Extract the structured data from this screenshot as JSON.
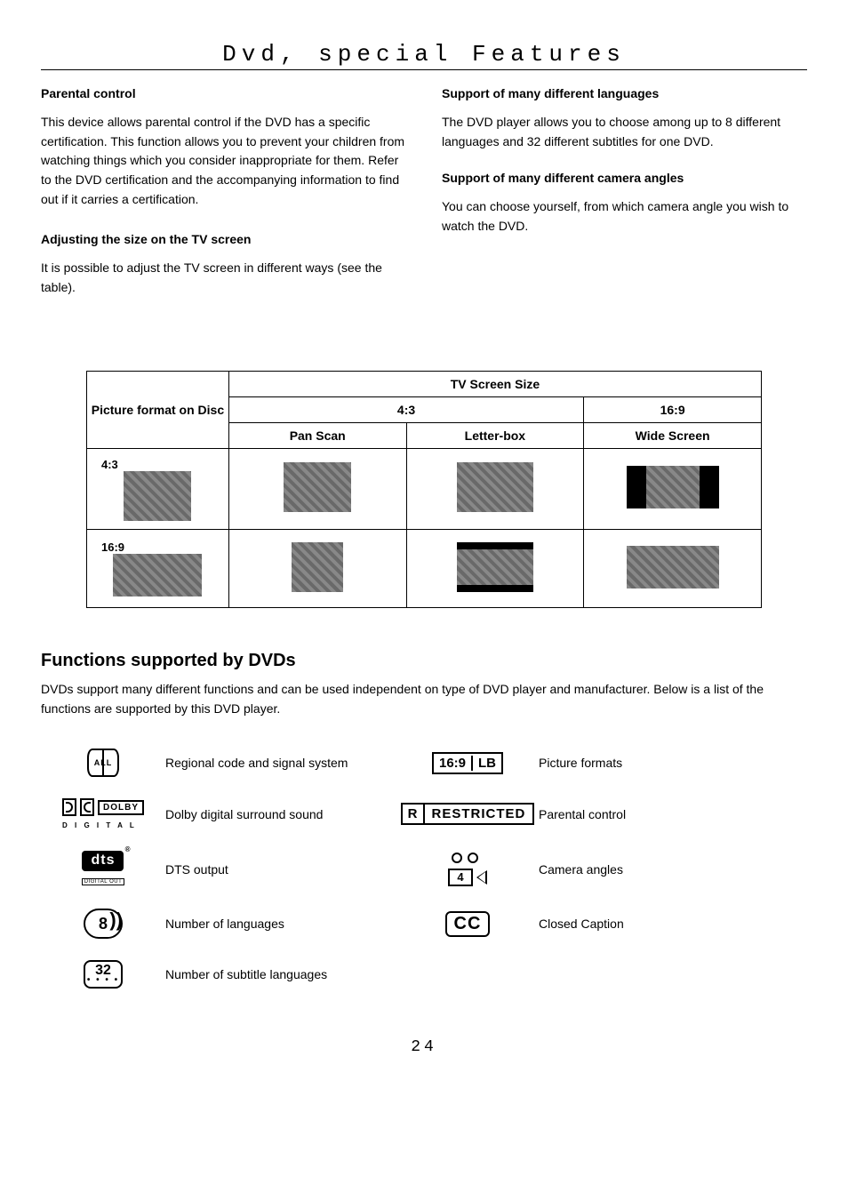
{
  "title": "Dvd, special Features",
  "left": {
    "h1": "Parental control",
    "p1": "This device allows parental control if the DVD has a specific certification. This function allows you to prevent your children from watching things which you consider inappropriate for them. Refer to the DVD certification and the accompanying information to find out if it carries a certification.",
    "h2": "Adjusting the size on the TV screen",
    "p2": "It is possible to adjust the TV screen in different ways (see the table)."
  },
  "right": {
    "h1": "Support of many different languages",
    "p1": "The DVD player allows you to choose among up to 8 different languages and 32 different subtitles for one DVD.",
    "h2": "Support of many different camera angles",
    "p2": "You can choose yourself, from which camera angle you wish to watch the DVD."
  },
  "table": {
    "tv_screen_size": "TV Screen Size",
    "picture_format": "Picture format on Disc",
    "r43": "4:3",
    "r169": "16:9",
    "pan_scan": "Pan Scan",
    "letter_box": "Letter-box",
    "wide_screen": "Wide Screen",
    "row1": "4:3",
    "row2": "16:9"
  },
  "funcs": {
    "heading": "Functions supported by DVDs",
    "intro": "DVDs support many different functions and can be used independent on type of DVD player and manufacturer. Below is a list of the functions are supported by this DVD player.",
    "items": {
      "regional": "Regional code and signal system",
      "dolby": "Dolby digital surround sound",
      "dts": "DTS output",
      "languages": "Number of languages",
      "subtitles": "Number of subtitle languages",
      "picture_formats": "Picture formats",
      "parental": "Parental control",
      "camera": "Camera angles",
      "cc": "Closed Caption"
    },
    "labels": {
      "globe": "ALL",
      "dolby_box": "DOLBY",
      "dolby_sub": "D I G I T A L",
      "dts": "dts",
      "dts_sub": "DIGITAL OUT",
      "lang_num": "8",
      "sub_num": "32",
      "pf_a": "16:9",
      "pf_b": "LB",
      "restr_r": "R",
      "restr_t": "RESTRICTED",
      "cam_num": "4",
      "cc": "CC"
    }
  },
  "page_number": "24"
}
